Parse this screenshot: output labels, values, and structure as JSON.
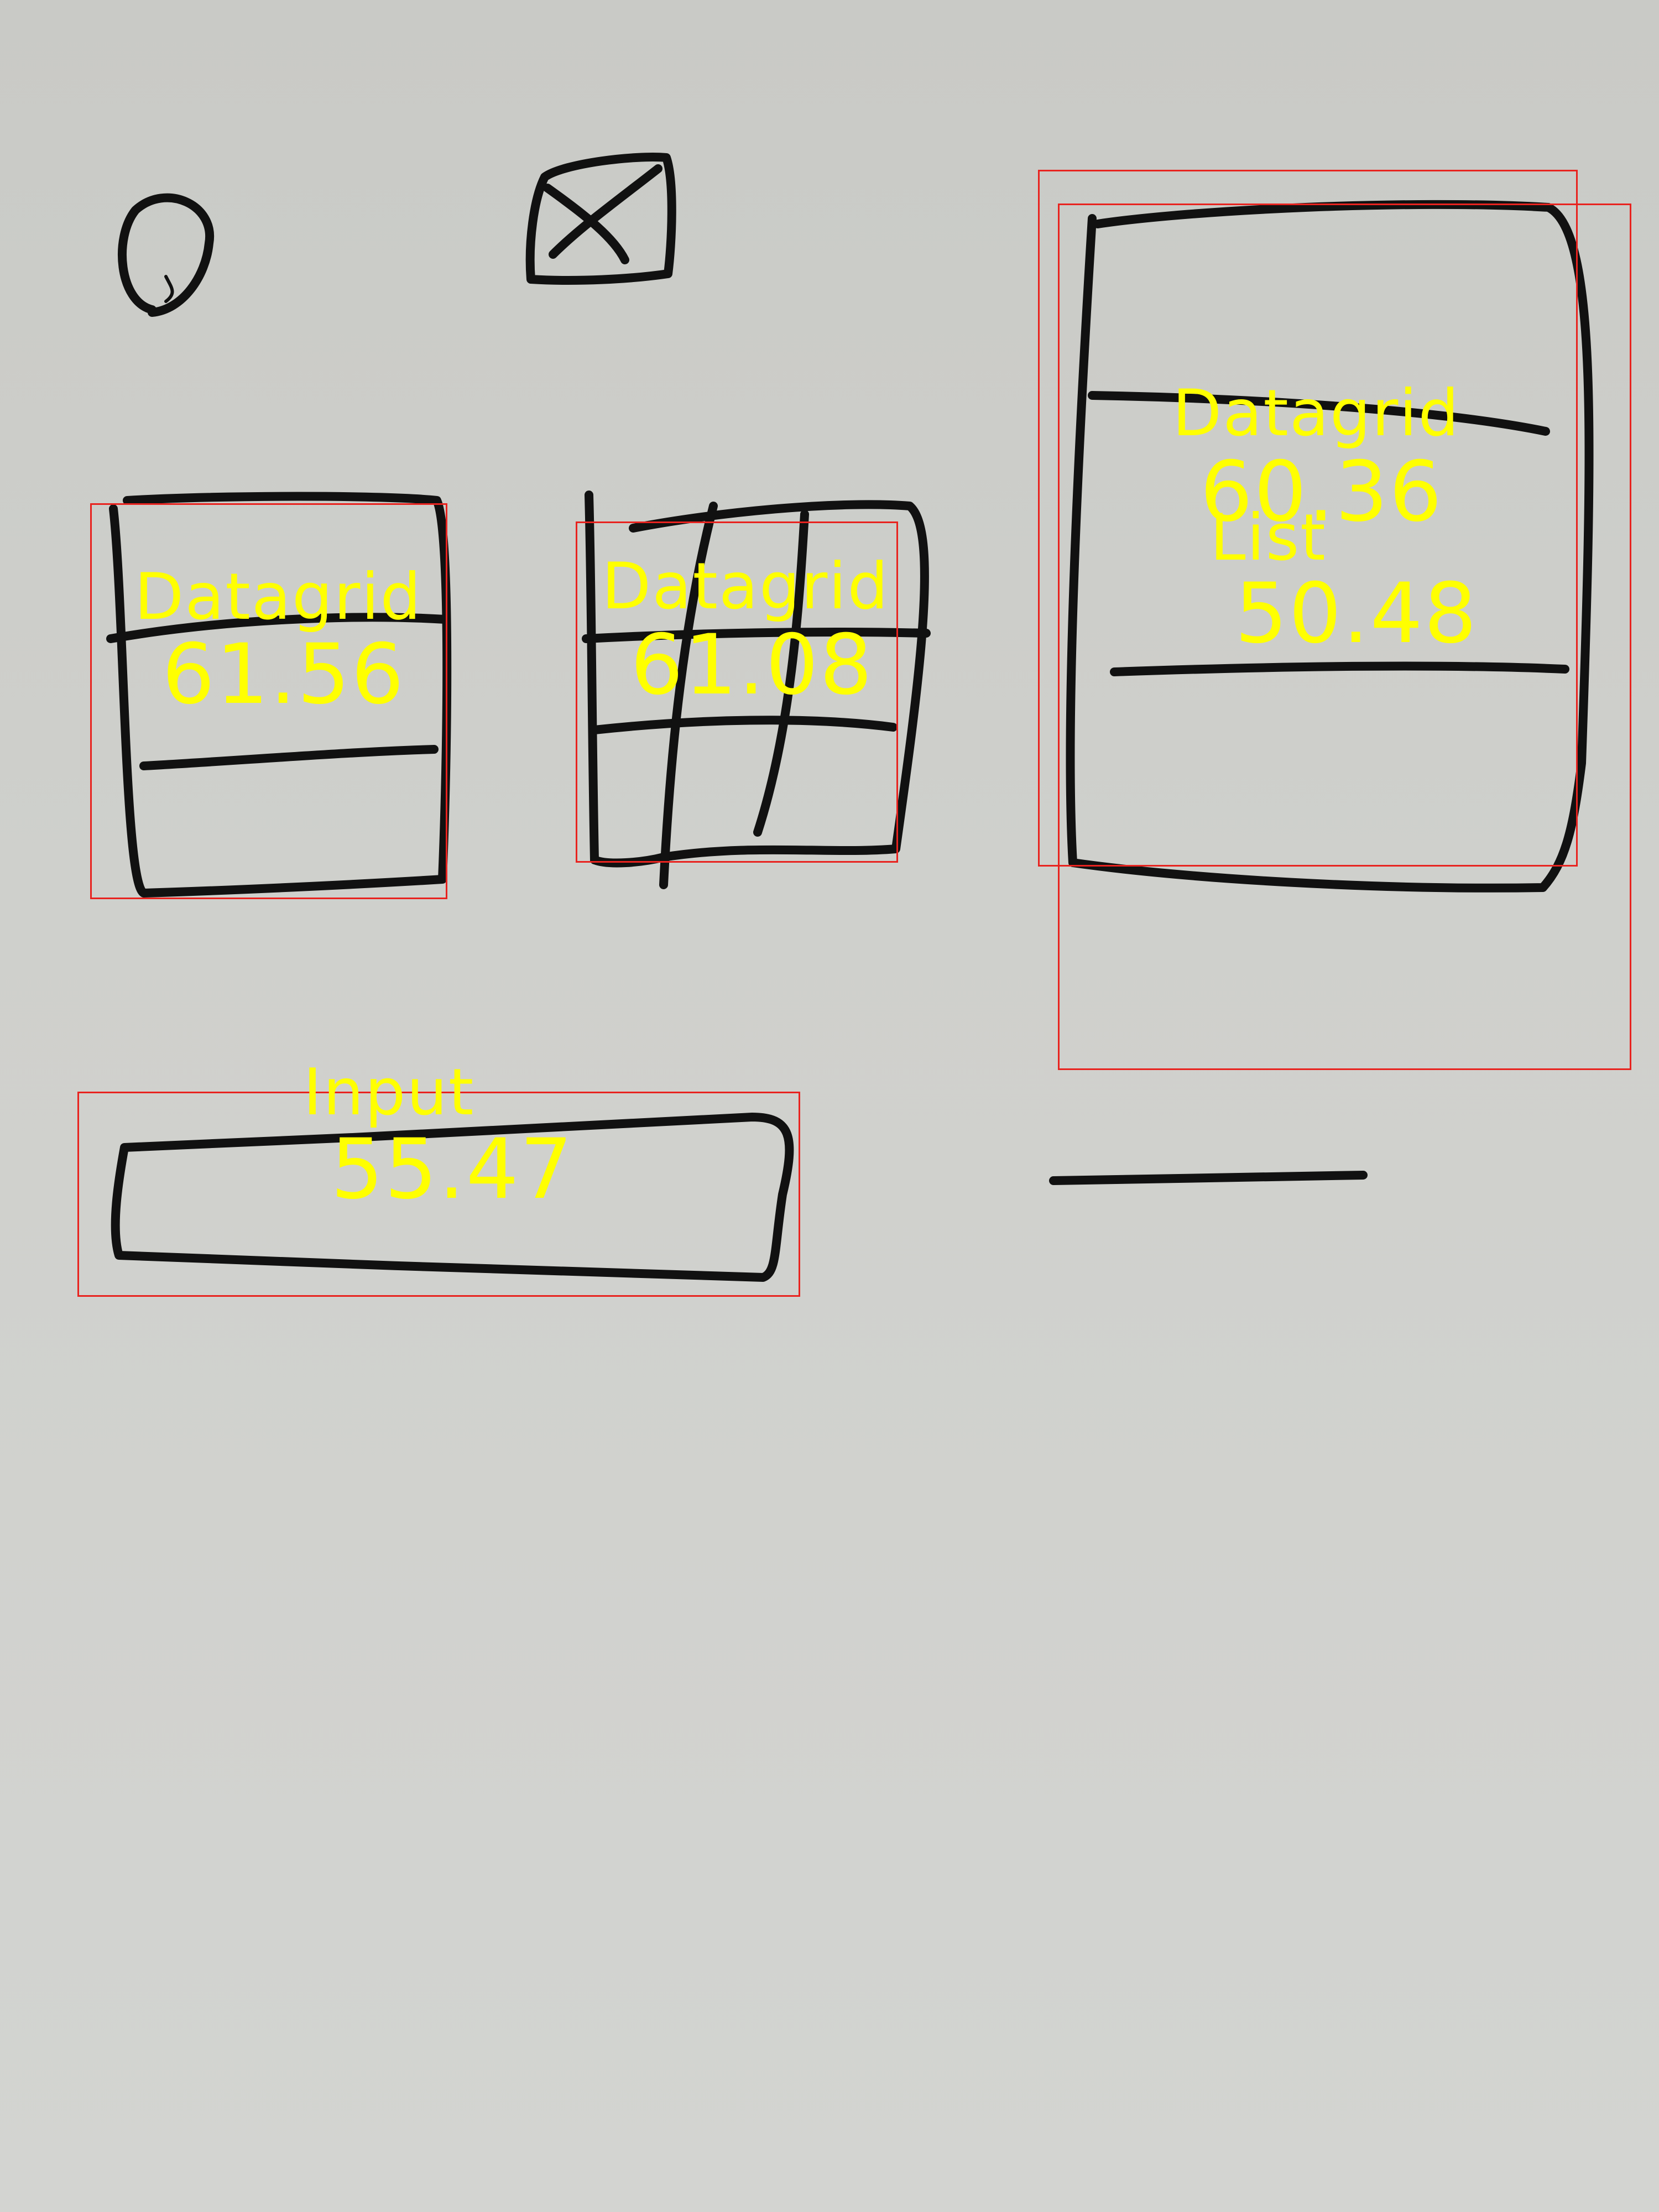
{
  "detections": [
    {
      "class_label": "Datagrid",
      "score": "61.56"
    },
    {
      "class_label": "Datagrid",
      "score": "61.08"
    },
    {
      "class_label": "Datagrid",
      "score": "60.36"
    },
    {
      "class_label": "List",
      "score": "50.48"
    },
    {
      "class_label": "Input",
      "score": "55.47"
    }
  ],
  "colors": {
    "box": "#e8231f",
    "label": "#ffff00",
    "marker": "#111111",
    "board": "#cdcec9"
  }
}
